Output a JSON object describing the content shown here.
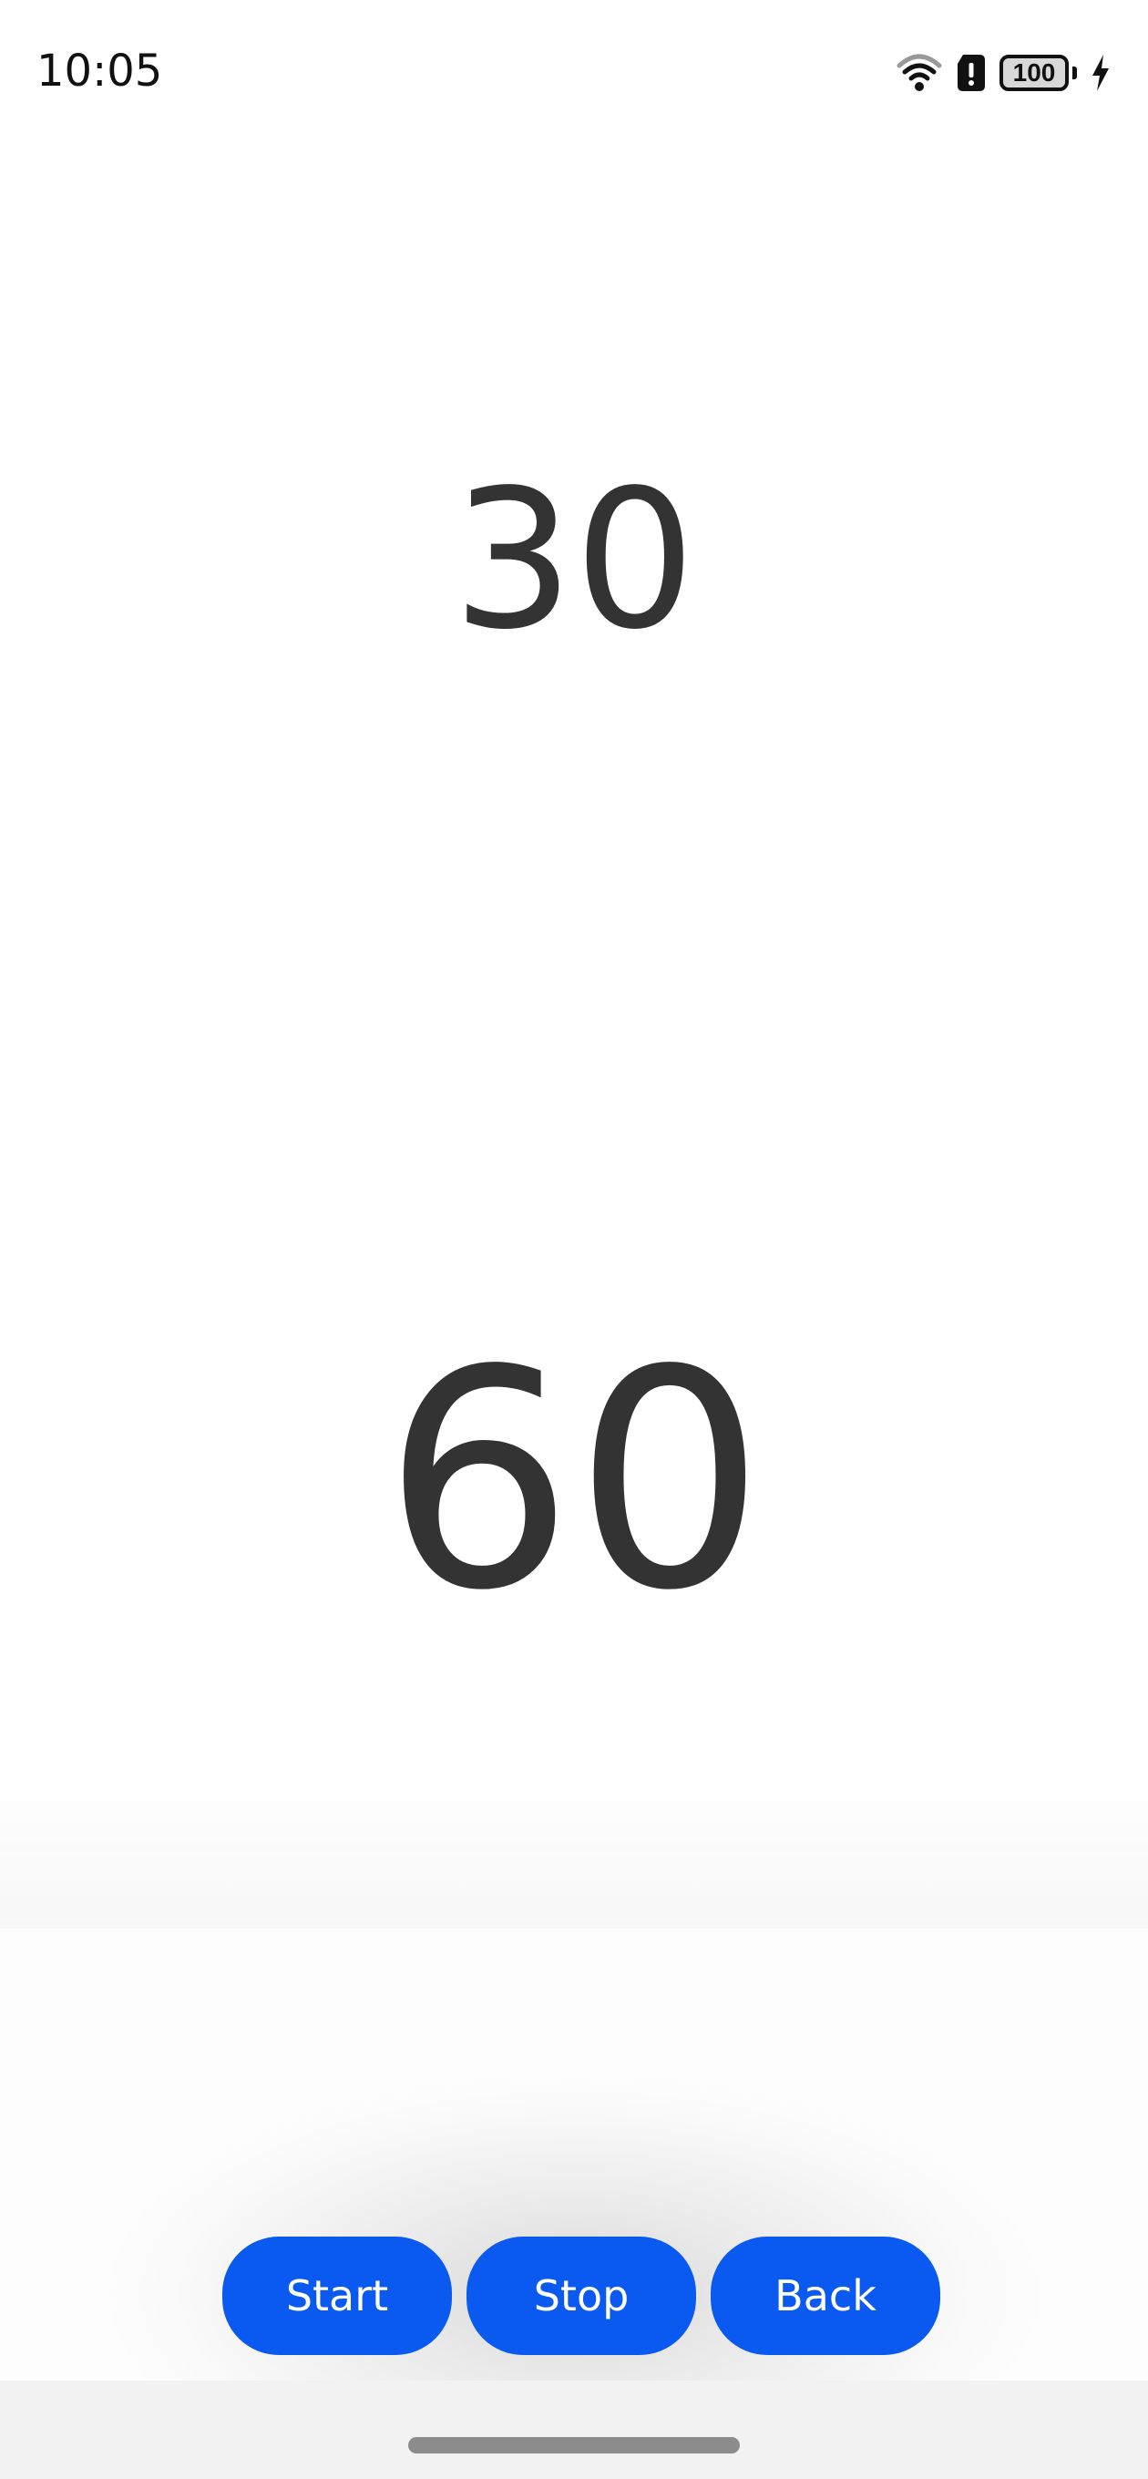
{
  "status_bar": {
    "time": "10:05",
    "battery": "100",
    "icons": [
      "wifi-icon",
      "sim-alert-icon",
      "battery-icon",
      "charging-icon"
    ]
  },
  "counters": {
    "top": "30",
    "main": "60"
  },
  "controls": {
    "start_label": "Start",
    "stop_label": "Stop",
    "back_label": "Back"
  },
  "colors": {
    "button": "#0a59f0",
    "number_text": "#333333"
  }
}
